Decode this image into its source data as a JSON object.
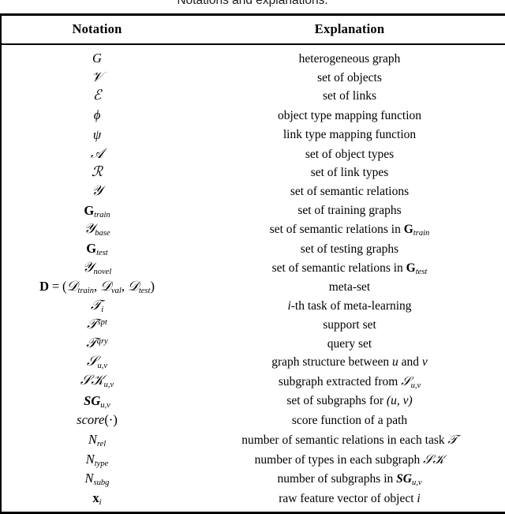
{
  "caption": "Notations and explanations.",
  "table": {
    "columns": [
      {
        "key": "notation",
        "label": "Notation"
      },
      {
        "key": "explanation",
        "label": "Explanation"
      }
    ],
    "rows": [
      {
        "notation": "G",
        "explanation": "heterogeneous graph"
      },
      {
        "notation": "ᵋ",
        "explanation": "set of objects"
      },
      {
        "notation": "ℰ",
        "explanation": "set of links"
      },
      {
        "notation": "ϕ",
        "explanation": "object type mapping function"
      },
      {
        "notation": "ψ",
        "explanation": "link type mapping function"
      },
      {
        "notation": "𝒜",
        "explanation": "set of object types"
      },
      {
        "notation": "ℛ",
        "explanation": "set of link types"
      },
      {
        "notation": "𝒴",
        "explanation": "set of semantic relations"
      },
      {
        "notation": "G_train",
        "explanation": "set of training graphs"
      },
      {
        "notation": "Y_base",
        "explanation": "set of semantic relations in G_train"
      },
      {
        "notation": "G_test",
        "explanation": "set of testing graphs"
      },
      {
        "notation": "Y_novel",
        "explanation": "set of semantic relations in G_test"
      },
      {
        "notation": "D = (D_train, D_val, D_test)",
        "explanation": "meta-set"
      },
      {
        "notation": "T_i",
        "explanation": "i-th task of meta-learning"
      },
      {
        "notation": "T^spt",
        "explanation": "support set"
      },
      {
        "notation": "T^qry",
        "explanation": "query set"
      },
      {
        "notation": "S_u,v",
        "explanation": "graph structure between u and v"
      },
      {
        "notation": "SG_u,v",
        "explanation": "subgraph extracted from S_u,v"
      },
      {
        "notation": "SG_u,v (bold)",
        "explanation": "set of subgraphs for (u, v)"
      },
      {
        "notation": "score(·)",
        "explanation": "score function of a path"
      },
      {
        "notation": "N_rel",
        "explanation": "number of semantic relations in each task T"
      },
      {
        "notation": "N_type",
        "explanation": "number of types in each subgraph SG"
      },
      {
        "notation": "N_subg",
        "explanation": "number of subgraphs in SG_u,v"
      },
      {
        "notation": "x_i",
        "explanation": "raw feature vector of object i"
      }
    ],
    "symbols": {
      "G": "G",
      "cal_V": "𝒱",
      "cal_E": "ℰ",
      "phi": "ϕ",
      "psi": "ψ",
      "cal_A": "𝒜",
      "cal_R": "ℛ",
      "cal_Y": "𝒴",
      "cal_D": "𝒟",
      "cal_T": "𝒯",
      "cal_S": "𝒮",
      "bold_G": "G",
      "bold_D": "D",
      "bold_x": "x",
      "N": "N",
      "score": "score",
      "cdot": "·",
      "u": "u",
      "v": "v",
      "i": "i",
      "sub_train": "train",
      "sub_test": "test",
      "sub_val": "val",
      "sub_base": "base",
      "sub_novel": "novel",
      "sub_rel": "rel",
      "sub_type": "type",
      "sub_subg": "subg",
      "sup_spt": "spt",
      "sup_qry": "qry",
      "equals": "=",
      "lparen": "(",
      "rparen": ")",
      "comma": ","
    },
    "phrases": {
      "het_graph": "heterogeneous graph",
      "set_objects": "set of objects",
      "set_links": "set of links",
      "obj_type_map": "object type mapping function",
      "link_type_map": "link type mapping function",
      "set_object_types": "set of object types",
      "set_link_types": "set of link types",
      "set_sem_rel": "set of semantic relations",
      "set_train_graphs": "set of training graphs",
      "set_sem_rel_in": "set of semantic relations in",
      "set_test_graphs": "set of testing graphs",
      "meta_set": "meta-set",
      "task_of_meta": "-th task of meta-learning",
      "support_set": "support set",
      "query_set": "query set",
      "graph_struct_between": "graph structure between",
      "and": "and",
      "subgraph_extracted": "subgraph extracted from",
      "set_subgraphs_for": "set of subgraphs for",
      "score_fn": "score function of a path",
      "num_sem_rel": "number of semantic relations in each task",
      "num_types": "number of types in each subgraph",
      "num_subgraphs": "number of subgraphs in",
      "raw_feature": "raw feature vector of object"
    }
  }
}
